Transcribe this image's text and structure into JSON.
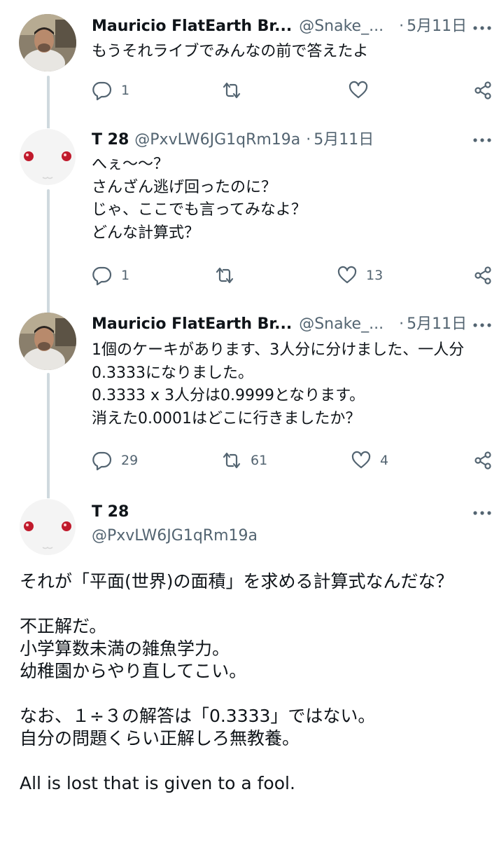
{
  "tweets": [
    {
      "name": "Mauricio FlatEarth Br...",
      "handle": "@Snake_...",
      "dot": "·",
      "date": "5月11日",
      "text": "もうそれライブでみんなの前で答えたよ",
      "reply_count": "1",
      "retweet_count": "",
      "like_count": ""
    },
    {
      "name": "T 28",
      "handle": "@PxvLW6JG1qRm19a",
      "dot": "·",
      "date": "5月11日",
      "text": "へぇ〜〜？\nさんざん逃げ回ったのに？\nじゃ、ここでも言ってみなよ？\nどんな計算式？",
      "reply_count": "1",
      "retweet_count": "",
      "like_count": "13"
    },
    {
      "name": "Mauricio FlatEarth Br...",
      "handle": "@Snake_...",
      "dot": "·",
      "date": "5月11日",
      "text": "1個のケーキがあります、3人分に分けました、一人分0.3333になりました。\n0.3333 x 3人分は0.9999となります。\n消えた0.0001はどこに行きましたか？",
      "reply_count": "29",
      "retweet_count": "61",
      "like_count": "4"
    }
  ],
  "main_tweet": {
    "name": "T 28",
    "handle": "@PxvLW6JG1qRm19a",
    "text": "それが「平面(世界)の面積」を求める計算式なんだな？\n\n不正解だ。\n小学算数未満の雑魚学力。\n幼稚園からやり直してこい。\n\nなお、１÷３の解答は「0.3333」ではない。\n自分の問題くらい正解しろ無教養。\n\nAll is lost that is given to a fool."
  },
  "icons": {
    "reply": "reply-icon",
    "retweet": "retweet-icon",
    "like": "heart-icon",
    "share": "share-icon",
    "more": "more-icon"
  },
  "colors": {
    "text": "#0f1419",
    "secondary": "#536471",
    "thread_line": "#cfd9de"
  }
}
